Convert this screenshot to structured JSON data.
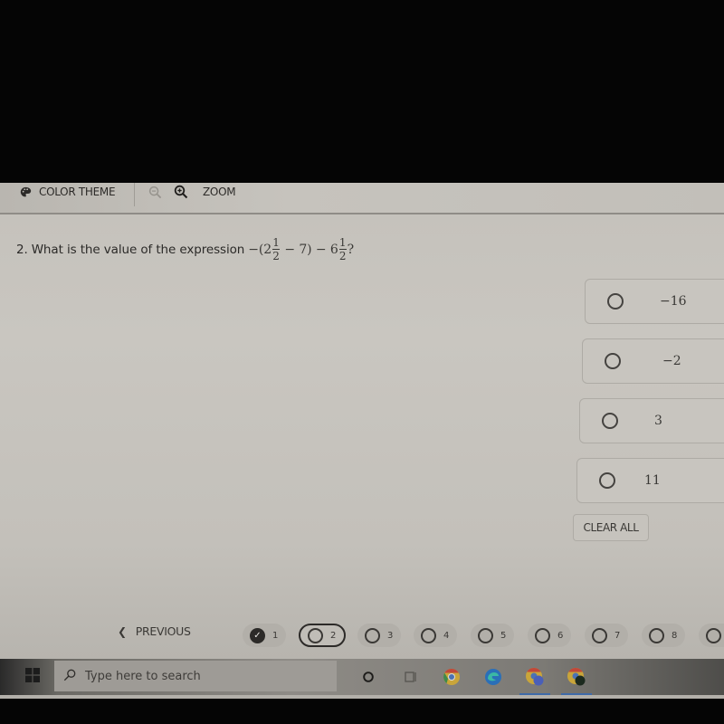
{
  "toolbar": {
    "color_theme_label": "COLOR THEME",
    "zoom_label": "ZOOM",
    "icons": [
      "palette-icon",
      "zoom-out-icon",
      "zoom-in-icon"
    ]
  },
  "question": {
    "number": "2.",
    "text": "What is the value of the expression",
    "expression": {
      "lead": "−(2",
      "frac1_num": "1",
      "frac1_den": "2",
      "mid": " − 7) − 6",
      "frac2_num": "1",
      "frac2_den": "2",
      "tail": "?"
    }
  },
  "options": [
    {
      "value": "−16",
      "selected": false
    },
    {
      "value": "−2",
      "selected": false
    },
    {
      "value": "3",
      "selected": false
    },
    {
      "value": "11",
      "selected": false
    }
  ],
  "clear_all_label": "CLEAR ALL",
  "navigation": {
    "previous_label": "PREVIOUS",
    "questions": [
      {
        "num": "1",
        "state": "answered"
      },
      {
        "num": "2",
        "state": "current"
      },
      {
        "num": "3",
        "state": "unanswered"
      },
      {
        "num": "4",
        "state": "unanswered"
      },
      {
        "num": "5",
        "state": "unanswered"
      },
      {
        "num": "6",
        "state": "unanswered"
      },
      {
        "num": "7",
        "state": "unanswered"
      },
      {
        "num": "8",
        "state": "unanswered"
      },
      {
        "num": "",
        "state": "unanswered"
      }
    ]
  },
  "taskbar": {
    "search_placeholder": "Type here to search",
    "apps": [
      "cortana-icon",
      "task-view-icon",
      "chrome-icon",
      "edge-icon",
      "chrome-profile-icon",
      "chrome-profile-2-icon"
    ]
  }
}
